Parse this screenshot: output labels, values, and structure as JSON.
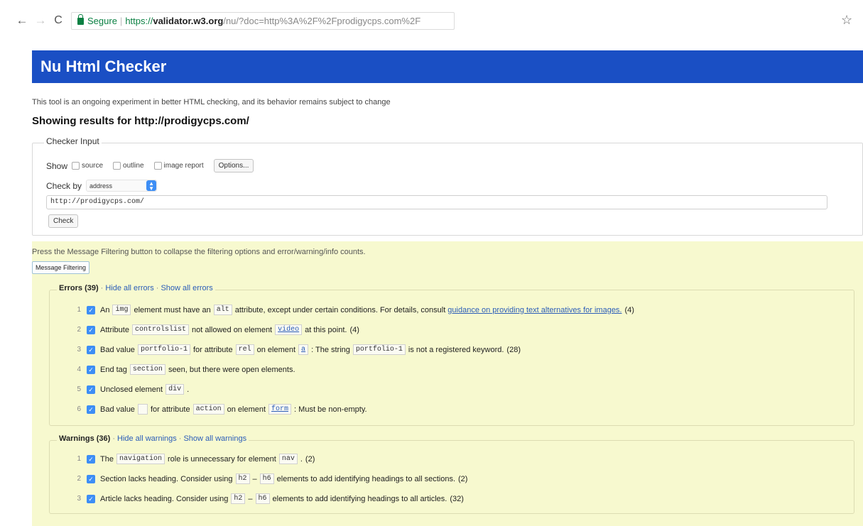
{
  "browser": {
    "secure_label": "Segure",
    "url_scheme": "https://",
    "url_host": "validator.w3.org",
    "url_path": "/nu/?doc=http%3A%2F%2Fprodigycps.com%2F"
  },
  "header": {
    "title": "Nu Html Checker"
  },
  "intro_text": "This tool is an ongoing experiment in better HTML checking, and its behavior remains subject to change",
  "results_heading": "Showing results for http://prodigycps.com/",
  "checker_input": {
    "legend": "Checker Input",
    "show_label": "Show",
    "options": [
      "source",
      "outline",
      "image report"
    ],
    "options_button": "Options...",
    "check_by_label": "Check by",
    "check_by_value": "address",
    "url_value": "http://prodigycps.com/",
    "check_button": "Check"
  },
  "filtering": {
    "note": "Press the Message Filtering button to collapse the filtering options and error/warning/info counts.",
    "button": "Message Filtering"
  },
  "errors": {
    "title": "Errors (39)",
    "hide_all": "Hide all errors",
    "show_all": "Show all errors",
    "items": [
      {
        "num": "1",
        "p1": "An",
        "c1": "img",
        "p2": "element must have an",
        "c2": "alt",
        "p3": "attribute, except under certain conditions. For details, consult",
        "link": "guidance on providing text alternatives for images.",
        "count": "(4)"
      },
      {
        "num": "2",
        "p1": "Attribute",
        "c1": "controlslist",
        "p2": "not allowed on element",
        "c2": "video",
        "p3": "at this point.",
        "count": "(4)"
      },
      {
        "num": "3",
        "p1": "Bad value",
        "c1": "portfolio-1",
        "p2": "for attribute",
        "c2": "rel",
        "p3": "on element",
        "c3": "a",
        "p4": ": The string",
        "c4": "portfolio-1",
        "p5": "is not a registered keyword.",
        "count": "(28)"
      },
      {
        "num": "4",
        "p1": "End tag",
        "c1": "section",
        "p2": "seen, but there were open elements."
      },
      {
        "num": "5",
        "p1": "Unclosed element",
        "c1": "div",
        "p2": "."
      },
      {
        "num": "6",
        "p1": "Bad value",
        "p2": "for attribute",
        "c2": "action",
        "p3": "on element",
        "c3": "form",
        "p4": ": Must be non-empty."
      }
    ]
  },
  "warnings": {
    "title": "Warnings (36)",
    "hide_all": "Hide all warnings",
    "show_all": "Show all warnings",
    "items": [
      {
        "num": "1",
        "p1": "The",
        "c1": "navigation",
        "p2": "role is unnecessary for element",
        "c2": "nav",
        "p3": ".",
        "count": "(2)"
      },
      {
        "num": "2",
        "p1": "Section lacks heading. Consider using",
        "c1": "h2",
        "c2": "h6",
        "p2": "elements to add identifying headings to all sections.",
        "count": "(2)"
      },
      {
        "num": "3",
        "p1": "Article lacks heading. Consider using",
        "c1": "h2",
        "c2": "h6",
        "p2": "elements to add identifying headings to all articles.",
        "count": "(32)"
      }
    ]
  },
  "icons": [
    "back-arrow-icon",
    "forward-arrow-icon",
    "reload-icon",
    "lock-icon",
    "star-icon",
    "checkbox-icon",
    "select-arrows-icon"
  ],
  "colors": {
    "banner": "#1a4fc4",
    "filter_bg": "#f7f9cf",
    "link": "#2b5db8",
    "secure": "#0b8043"
  }
}
